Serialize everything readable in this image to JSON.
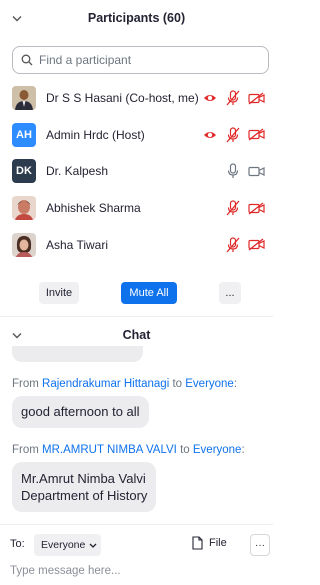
{
  "participants_panel": {
    "title": "Participants (60)",
    "search_placeholder": "Find a participant",
    "participants": [
      {
        "name": "Dr S S Hasani (Co-host, me)",
        "avatar": "photo",
        "avatar_color": "#6b4a2d"
      },
      {
        "name": "Admin Hrdc (Host)",
        "avatar": "AH",
        "avatar_color": "#2d8cff"
      },
      {
        "name": "Dr. Kalpesh",
        "avatar": "DK",
        "avatar_color": "#2d3b4f"
      },
      {
        "name": "Abhishek Sharma",
        "avatar": "photo",
        "avatar_color": "#c46a5a"
      },
      {
        "name": "Asha Tiwari",
        "avatar": "photo",
        "avatar_color": "#a8746a"
      }
    ],
    "buttons": {
      "invite": "Invite",
      "mute_all": "Mute All",
      "more": "..."
    }
  },
  "chat_panel": {
    "title": "Chat",
    "messages": [
      {
        "from": "Rajendrakumar Hittanagi",
        "to": "Everyone",
        "text": "good afternoon to all"
      },
      {
        "from": "MR.AMRUT NIMBA VALVI",
        "to": "Everyone",
        "text_lines": [
          "Mr.Amrut Nimba Valvi",
          "Department of History"
        ]
      }
    ],
    "from_word": "From",
    "to_word": "to",
    "to_label": "To:",
    "to_value": "Everyone",
    "file_label": "File",
    "more_label": "···",
    "input_placeholder": "Type message here..."
  },
  "colors": {
    "accent": "#0e72ed",
    "muted_red": "#e02828",
    "bubble": "#ececef"
  }
}
